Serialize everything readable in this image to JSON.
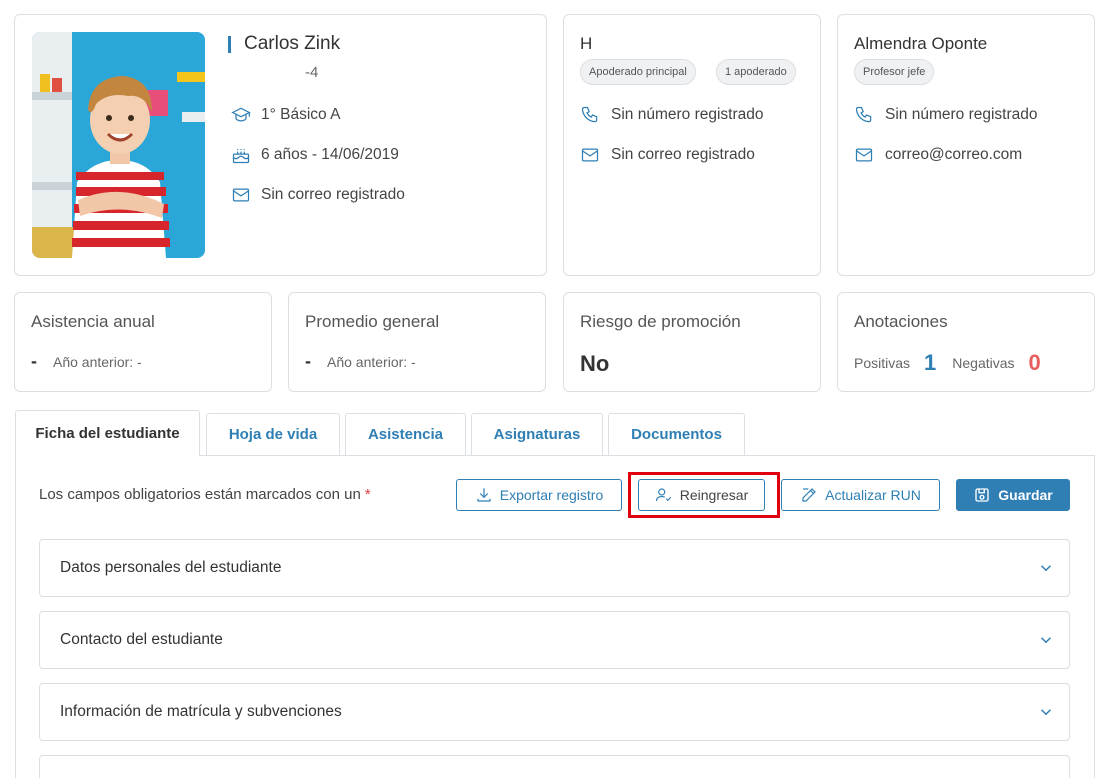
{
  "student": {
    "name": "Carlos Zink",
    "run": "-4",
    "course": "1° Básico A",
    "age_birth": "6 años - 14/06/2019",
    "email": "Sin correo registrado"
  },
  "guardian": {
    "name": "H",
    "chips": [
      "Apoderado principal",
      "1 apoderado"
    ],
    "phone": "Sin número registrado",
    "email": "Sin correo registrado"
  },
  "teacher": {
    "name": "Almendra Oponte",
    "chip": "Profesor jefe",
    "phone": "Sin número registrado",
    "email": "correo@correo.com"
  },
  "stats": {
    "attendance": {
      "title": "Asistencia anual",
      "value": "-",
      "previous": "Año anterior: -"
    },
    "average": {
      "title": "Promedio general",
      "value": "-",
      "previous": "Año anterior: -"
    },
    "risk": {
      "title": "Riesgo de promoción",
      "value": "No"
    },
    "annotations": {
      "title": "Anotaciones",
      "positive_label": "Positivas",
      "positive": "1",
      "negative_label": "Negativas",
      "negative": "0"
    }
  },
  "tabs": [
    "Ficha del estudiante",
    "Hoja de vida",
    "Asistencia",
    "Asignaturas",
    "Documentos"
  ],
  "form": {
    "required_note": "Los campos obligatorios están marcados con un",
    "required_star": "*",
    "buttons": {
      "export": "Exportar registro",
      "reingresar": "Reingresar",
      "update_run": "Actualizar RUN",
      "save": "Guardar"
    },
    "sections": [
      "Datos personales del estudiante",
      "Contacto del estudiante",
      "Información de matrícula y subvenciones",
      ""
    ]
  },
  "colors": {
    "accent": "#2f7fb5",
    "negative": "#e85d5d",
    "highlight": "#e0000e"
  }
}
